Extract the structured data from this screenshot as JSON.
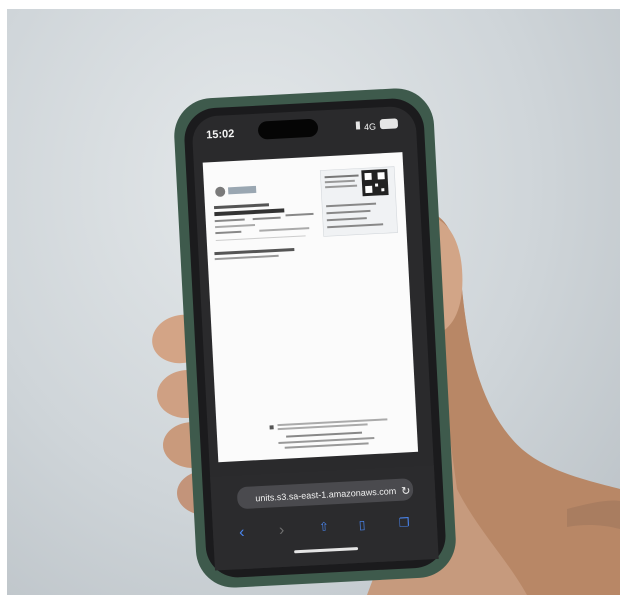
{
  "status_bar": {
    "time": "15:02",
    "network": "4G"
  },
  "browser": {
    "url": "units.s3.sa-east-1.amazonaws.com"
  },
  "icons": {
    "reload": "reload-icon",
    "back": "chevron-left-icon",
    "forward": "chevron-right-icon",
    "share": "share-icon",
    "bookmarks": "book-icon",
    "tabs": "tabs-icon"
  },
  "colors": {
    "background": "#cfd5d9",
    "phone_case": "#4f6b5d",
    "skin": "#c89a7c",
    "link_blue": "#2f6fe0"
  }
}
